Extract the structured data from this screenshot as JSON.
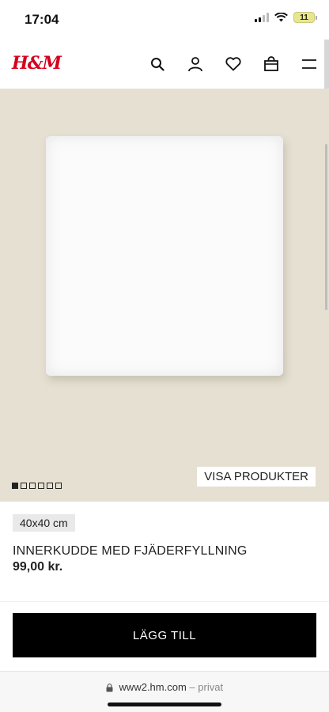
{
  "status_bar": {
    "time": "17:04",
    "battery": "11"
  },
  "header": {
    "logo": "H&M",
    "icons": [
      "search-icon",
      "account-icon",
      "favorites-icon",
      "bag-icon",
      "menu-icon"
    ]
  },
  "hero": {
    "visa_produkter": "VISA PRODUKTER",
    "slides_total": 6,
    "slide_active": 1
  },
  "product": {
    "size": "40x40 cm",
    "name": "INNERKUDDE MED FJÄDERFYLLNING",
    "price": "99,00 kr."
  },
  "actions": {
    "add_to_cart": "LÄGG TILL"
  },
  "browser": {
    "url": "www2.hm.com",
    "privacy": "– privat"
  },
  "colors": {
    "brand_red": "#d5001c",
    "button_black": "#000000",
    "hero_bg": "#e6e0d2"
  }
}
